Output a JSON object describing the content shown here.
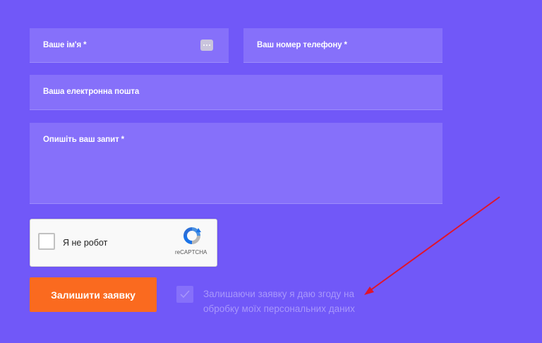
{
  "form": {
    "name": {
      "label": "Ваше ім'я",
      "required": "*"
    },
    "phone": {
      "label": "Ваш номер телефону",
      "required": "*"
    },
    "email": {
      "label": "Ваша електронна пошта"
    },
    "message": {
      "label": "Опишіть ваш запит",
      "required": "*"
    },
    "captcha": {
      "label": "Я не робот",
      "brand": "reCAPTCHA"
    },
    "submit_label": "Залишити заявку",
    "consent": {
      "text": "Залишаючи заявку я даю згоду на обробку моїх персональних даних",
      "checked": true
    }
  },
  "colors": {
    "background": "#7158f8",
    "field": "#8670fa",
    "submit": "#fa6a1f",
    "annotation_arrow": "#e0142c"
  },
  "icons": [
    "password-manager-icon",
    "recaptcha-logo-icon",
    "checkmark-icon",
    "annotation-arrow"
  ]
}
